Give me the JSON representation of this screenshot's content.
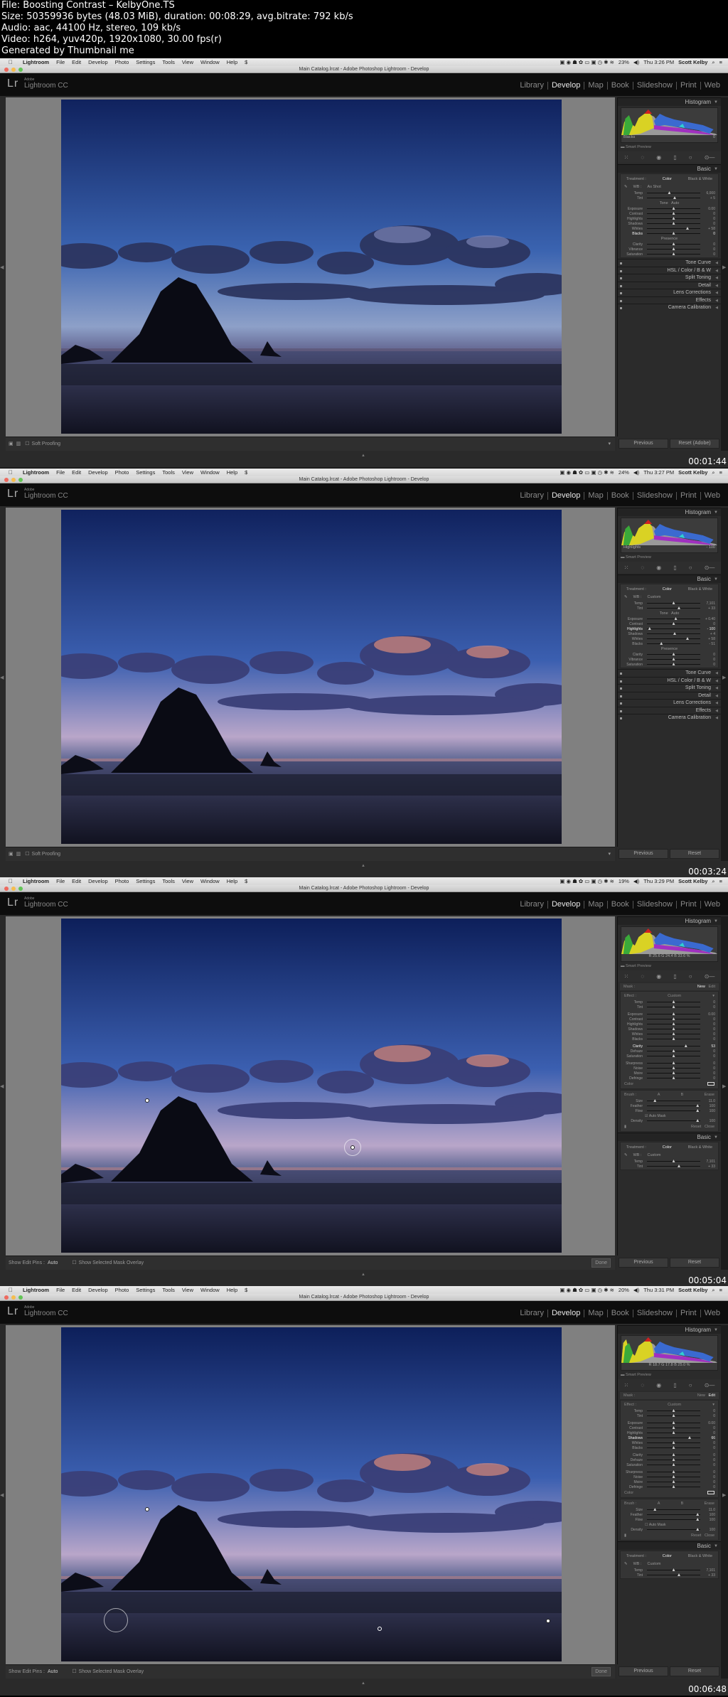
{
  "meta": {
    "lines": [
      "File: Boosting Contrast – KelbyOne.TS",
      "Size: 50359936 bytes (48.03 MiB), duration: 00:08:29, avg.bitrate: 792 kb/s",
      "Audio: aac, 44100 Hz, stereo, 109 kb/s",
      "Video: h264, yuv420p, 1920x1080, 30.00 fps(r)",
      "Generated by Thumbnail me"
    ]
  },
  "common": {
    "menu": [
      "Lightroom",
      "File",
      "Edit",
      "Develop",
      "Photo",
      "Settings",
      "Tools",
      "View",
      "Window",
      "Help"
    ],
    "window_title": "Main Catalog.lrcat - Adobe Photoshop Lightroom - Develop",
    "user": "Scott Kelby",
    "logo": "Lr",
    "logo_sub": "Adobe",
    "logo_name": "Lightroom CC",
    "modules": [
      "Library",
      "Develop",
      "Map",
      "Book",
      "Slideshow",
      "Print",
      "Web"
    ],
    "active_module": "Develop",
    "panels": [
      "Tone Curve",
      "HSL / Color / B & W",
      "Split Toning",
      "Detail",
      "Lens Corrections",
      "Effects",
      "Camera Calibration"
    ],
    "histogram_title": "Histogram",
    "smart_preview": "Smart Preview",
    "basic_title": "Basic",
    "treatment_label": "Treatment :",
    "treatment_color": "Color",
    "treatment_bw": "Black & White",
    "previous": "Previous",
    "soft_proofing": "Soft Proofing",
    "show_edit_pins": "Show Edit Pins :",
    "edit_pins_value": "Auto",
    "show_mask_overlay": "Show Selected Mask Overlay",
    "done": "Done",
    "colors": {
      "accent_red": "#ee6a5f",
      "accent_yellow": "#f5bd4f",
      "accent_green": "#61c454"
    }
  },
  "frames": [
    {
      "timestamp": "00:01:44",
      "clock": "Thu 3:26 PM",
      "battery": "23%",
      "histo_label_left": "Blacks",
      "histo_label_right": "0",
      "reset_label": "Reset (Adobe)",
      "wb_label": "WB :",
      "wb_value": "As Shot",
      "sliders": [
        {
          "label": "Temp",
          "value": "6,000",
          "pos": 0.42
        },
        {
          "label": "Tint",
          "value": "+ 5",
          "pos": 0.52
        },
        {
          "label": "Exposure",
          "value": "0.00",
          "pos": 0.5
        },
        {
          "label": "Contrast",
          "value": "0",
          "pos": 0.5
        },
        {
          "label": "Highlights",
          "value": "0",
          "pos": 0.5
        },
        {
          "label": "Shadows",
          "value": "0",
          "pos": 0.5
        },
        {
          "label": "Whites",
          "value": "+ 58",
          "pos": 0.76
        },
        {
          "label": "Blacks",
          "value": "0",
          "pos": 0.5,
          "hl": true
        },
        {
          "label": "Clarity",
          "value": "0",
          "pos": 0.5
        },
        {
          "label": "Vibrance",
          "value": "0",
          "pos": 0.5
        },
        {
          "label": "Saturation",
          "value": "0",
          "pos": 0.5
        }
      ],
      "tone_label": "Tone",
      "auto_label": "Auto",
      "presence_label": "Presence"
    },
    {
      "timestamp": "00:03:24",
      "clock": "Thu 3:27 PM",
      "battery": "24%",
      "histo_label_left": "Highlights",
      "histo_label_right": "- 100",
      "reset_label": "Reset",
      "wb_label": "WB :",
      "wb_value": "Custom",
      "sliders": [
        {
          "label": "Temp",
          "value": "7,101",
          "pos": 0.5
        },
        {
          "label": "Tint",
          "value": "+ 33",
          "pos": 0.6
        },
        {
          "label": "Exposure",
          "value": "+ 0.40",
          "pos": 0.54
        },
        {
          "label": "Contrast",
          "value": "0",
          "pos": 0.5
        },
        {
          "label": "Highlights",
          "value": "- 100",
          "pos": 0.05,
          "hl": true
        },
        {
          "label": "Shadows",
          "value": "+ 4",
          "pos": 0.52
        },
        {
          "label": "Whites",
          "value": "+ 58",
          "pos": 0.76
        },
        {
          "label": "Blacks",
          "value": "- 51",
          "pos": 0.27
        },
        {
          "label": "Clarity",
          "value": "0",
          "pos": 0.5
        },
        {
          "label": "Vibrance",
          "value": "0",
          "pos": 0.5
        },
        {
          "label": "Saturation",
          "value": "0",
          "pos": 0.5
        }
      ],
      "tone_label": "Tone",
      "auto_label": "Auto",
      "presence_label": "Presence"
    },
    {
      "timestamp": "00:05:04",
      "clock": "Thu 3:29 PM",
      "battery": "19%",
      "rgb": "R 25.6  G 24.4  B 33.6 %",
      "reset_label": "Reset",
      "mask_label": "Mask :",
      "mask_new": "New",
      "mask_edit": "Edit",
      "effect_label": "Effect :",
      "effect_value": "Custom",
      "sliders": [
        {
          "label": "Temp",
          "value": "0",
          "pos": 0.5
        },
        {
          "label": "Tint",
          "value": "0",
          "pos": 0.5
        },
        {
          "label": "Exposure",
          "value": "0.00",
          "pos": 0.5
        },
        {
          "label": "Contrast",
          "value": "0",
          "pos": 0.5
        },
        {
          "label": "Highlights",
          "value": "0",
          "pos": 0.5
        },
        {
          "label": "Shadows",
          "value": "0",
          "pos": 0.5
        },
        {
          "label": "Whites",
          "value": "0",
          "pos": 0.5
        },
        {
          "label": "Blacks",
          "value": "0",
          "pos": 0.5
        },
        {
          "label": "Clarity",
          "value": "53",
          "pos": 0.73,
          "hl": true
        },
        {
          "label": "Dehaze",
          "value": "0",
          "pos": 0.5
        },
        {
          "label": "Saturation",
          "value": "0",
          "pos": 0.5
        },
        {
          "label": "Sharpness",
          "value": "0",
          "pos": 0.5
        },
        {
          "label": "Noise",
          "value": "0",
          "pos": 0.5
        },
        {
          "label": "Moire",
          "value": "0",
          "pos": 0.5
        },
        {
          "label": "Defringe",
          "value": "0",
          "pos": 0.5
        }
      ],
      "color_label": "Color",
      "brush": {
        "label": "Brush :",
        "a": "A",
        "b": "B",
        "erase": "Erase",
        "sliders": [
          {
            "label": "Size",
            "value": "11.0",
            "pos": 0.15
          },
          {
            "label": "Feather",
            "value": "100",
            "pos": 0.95
          },
          {
            "label": "Flow",
            "value": "100",
            "pos": 0.95
          },
          {
            "label": "Density",
            "value": "100",
            "pos": 0.95
          }
        ],
        "auto_mask": "Auto Mask",
        "auto_mask_checked": true,
        "reset": "Reset",
        "close": "Close"
      },
      "wb_label": "WB :",
      "wb_value": "Custom",
      "basic_sliders": [
        {
          "label": "Temp",
          "value": "7,101",
          "pos": 0.5
        },
        {
          "label": "Tint",
          "value": "+ 33",
          "pos": 0.6
        }
      ]
    },
    {
      "timestamp": "00:06:48",
      "clock": "Thu 3:31 PM",
      "battery": "20%",
      "rgb": "R 18.7  G 17.8  B 25.0 %",
      "reset_label": "Reset",
      "mask_label": "Mask :",
      "mask_new": "New",
      "mask_edit": "Edit",
      "effect_label": "Effect :",
      "effect_value": "Custom",
      "sliders": [
        {
          "label": "Temp",
          "value": "0",
          "pos": 0.5
        },
        {
          "label": "Tint",
          "value": "0",
          "pos": 0.5
        },
        {
          "label": "Exposure",
          "value": "0.00",
          "pos": 0.5
        },
        {
          "label": "Contrast",
          "value": "0",
          "pos": 0.5
        },
        {
          "label": "Highlights",
          "value": "0",
          "pos": 0.5
        },
        {
          "label": "Shadows",
          "value": "66",
          "pos": 0.8,
          "hl": true
        },
        {
          "label": "Whites",
          "value": "0",
          "pos": 0.5
        },
        {
          "label": "Blacks",
          "value": "0",
          "pos": 0.5
        },
        {
          "label": "Clarity",
          "value": "0",
          "pos": 0.5
        },
        {
          "label": "Dehaze",
          "value": "0",
          "pos": 0.5
        },
        {
          "label": "Saturation",
          "value": "0",
          "pos": 0.5
        },
        {
          "label": "Sharpness",
          "value": "0",
          "pos": 0.5
        },
        {
          "label": "Noise",
          "value": "0",
          "pos": 0.5
        },
        {
          "label": "Moire",
          "value": "0",
          "pos": 0.5
        },
        {
          "label": "Defringe",
          "value": "0",
          "pos": 0.5
        }
      ],
      "color_label": "Color",
      "brush": {
        "label": "Brush :",
        "a": "A",
        "b": "B",
        "erase": "Erase",
        "sliders": [
          {
            "label": "Size",
            "value": "11.0",
            "pos": 0.15
          },
          {
            "label": "Feather",
            "value": "100",
            "pos": 0.95
          },
          {
            "label": "Flow",
            "value": "100",
            "pos": 0.95
          },
          {
            "label": "Density",
            "value": "100",
            "pos": 0.95
          }
        ],
        "auto_mask": "Auto Mask",
        "auto_mask_checked": false,
        "reset": "Reset",
        "close": "Close"
      },
      "wb_label": "WB :",
      "wb_value": "Custom",
      "basic_sliders": [
        {
          "label": "Temp",
          "value": "7,101",
          "pos": 0.5
        },
        {
          "label": "Tint",
          "value": "+ 33",
          "pos": 0.6
        }
      ]
    }
  ]
}
